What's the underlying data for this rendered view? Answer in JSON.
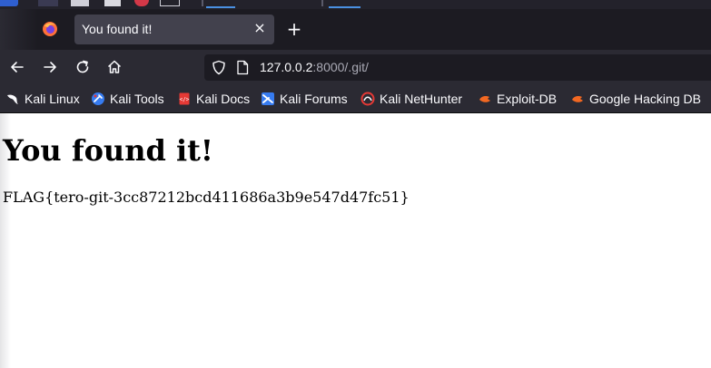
{
  "browser": {
    "tab": {
      "title": "You found it!",
      "close_glyph": "×"
    },
    "new_tab_glyph": "+",
    "url": {
      "host": "127.0.0.2",
      "rest": ":8000/.git/"
    },
    "icons": {
      "firefox": "firefox-icon",
      "back": "back-arrow-icon",
      "forward": "forward-arrow-icon",
      "reload": "reload-icon",
      "home": "home-icon",
      "shield": "tracking-protection-shield-icon",
      "page": "page-icon"
    },
    "bookmarks": [
      {
        "label": "Kali Linux",
        "icon": "kali-dragon-icon"
      },
      {
        "label": "Kali Tools",
        "icon": "kali-tools-icon"
      },
      {
        "label": "Kali Docs",
        "icon": "kali-docs-icon"
      },
      {
        "label": "Kali Forums",
        "icon": "kali-forums-icon"
      },
      {
        "label": "Kali NetHunter",
        "icon": "nethunter-icon"
      },
      {
        "label": "Exploit-DB",
        "icon": "exploit-db-icon"
      },
      {
        "label": "Google Hacking DB",
        "icon": "ghdb-icon"
      }
    ]
  },
  "page": {
    "heading": "You found it!",
    "flag": "FLAG{tero-git-3cc87212bcd411686a3b9e547d47fc51}"
  },
  "colors": {
    "toolbar": "#2b2a33",
    "tabstrip": "#1c1b22",
    "active_tab": "#42414d",
    "accent": "#4a90e2"
  }
}
